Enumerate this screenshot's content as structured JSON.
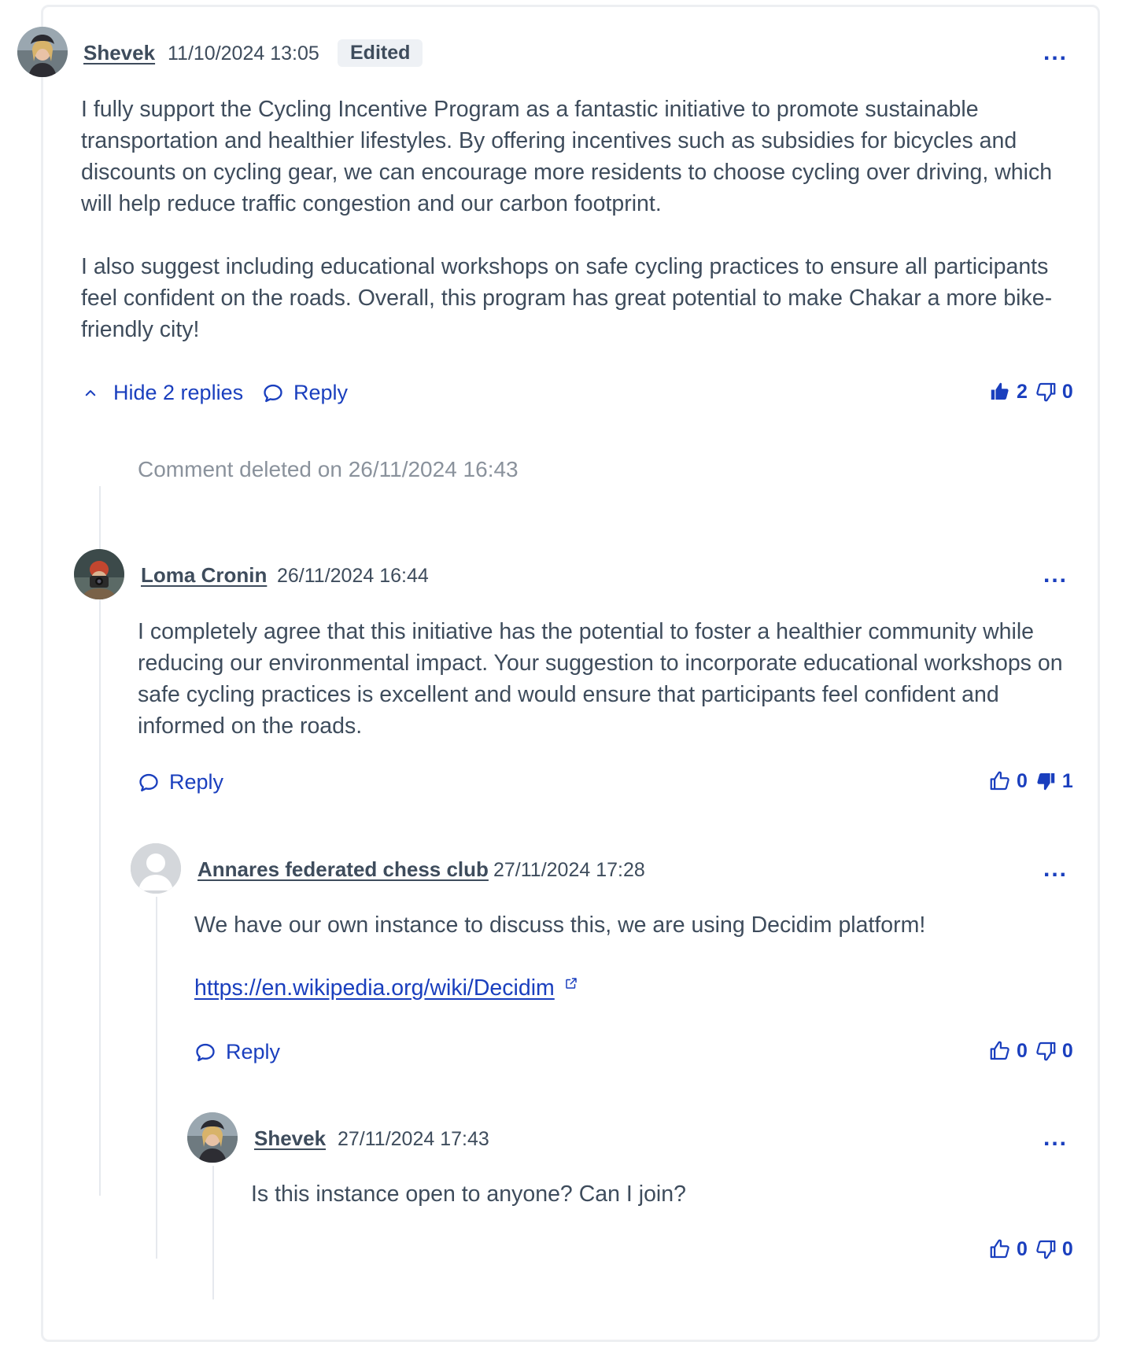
{
  "comment": {
    "author": "Shevek",
    "date": "11/10/2024 13:05",
    "edited_badge": "Edited",
    "paragraphs": [
      "I fully support the Cycling Incentive Program as a fantastic initiative to promote sustainable transportation and healthier lifestyles. By offering incentives such as subsidies for bicycles and discounts on cycling gear, we can encourage more residents to choose cycling over driving, which will help reduce traffic congestion and our carbon footprint.",
      "I also suggest including educational workshops on safe cycling practices to ensure all participants feel confident on the roads. Overall, this program has great potential to make Chakar a more bike-friendly city!"
    ],
    "hide_replies_label": "Hide 2 replies",
    "reply_label": "Reply",
    "upvotes": "2",
    "downvotes": "0",
    "more_label": "..."
  },
  "deleted_notice": "Comment deleted on 26/11/2024 16:43",
  "reply1": {
    "author": "Loma Cronin",
    "date": "26/11/2024 16:44",
    "text": "I completely agree that this initiative has the potential to foster a healthier community while reducing our environmental impact. Your suggestion to incorporate educational workshops on safe cycling practices is excellent and would ensure that participants feel confident and informed on the roads.",
    "reply_label": "Reply",
    "upvotes": "0",
    "downvotes": "1",
    "more_label": "..."
  },
  "reply2": {
    "author": "Annares federated chess club",
    "date": "27/11/2024 17:28",
    "text": "We have our own instance to discuss this, we are using Decidim platform!",
    "link": "https://en.wikipedia.org/wiki/Decidim",
    "reply_label": "Reply",
    "upvotes": "0",
    "downvotes": "0",
    "more_label": "..."
  },
  "reply3": {
    "author": "Shevek",
    "date": "27/11/2024 17:43",
    "text": "Is this instance open to anyone? Can I join?",
    "upvotes": "0",
    "downvotes": "0",
    "more_label": "..."
  },
  "colors": {
    "accent": "#1a3fbe",
    "text": "#3e4c5c",
    "muted": "#8a929c",
    "border": "#edeff2"
  }
}
